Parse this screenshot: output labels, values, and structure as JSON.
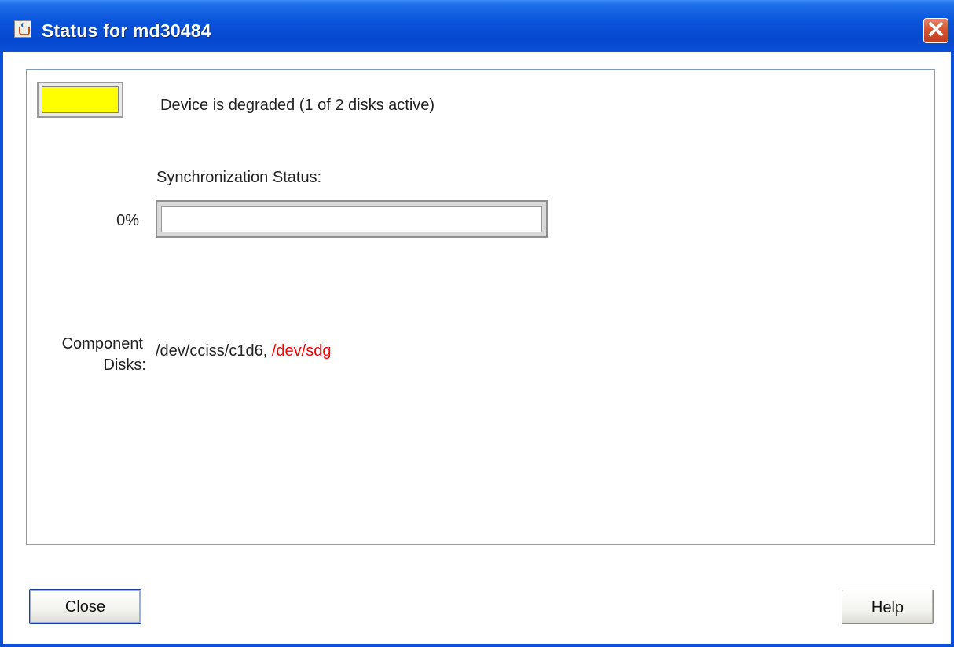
{
  "window": {
    "title": "Status for md30484",
    "title_icon": "java-cup-icon",
    "close_icon": "close-icon"
  },
  "status": {
    "indicator_color": "#ffff00",
    "message": "Device is degraded (1 of 2 disks active)"
  },
  "sync": {
    "label": "Synchronization Status:",
    "percent_text": "0%",
    "progress_fraction": 0
  },
  "components": {
    "label_line1": "Component",
    "label_line2": "Disks:",
    "disk_active": "/dev/cciss/c1d6",
    "separator": ",",
    "disk_failed": "/dev/sdg",
    "failed_color": "#ff0000"
  },
  "buttons": {
    "close": "Close",
    "help": "Help"
  }
}
